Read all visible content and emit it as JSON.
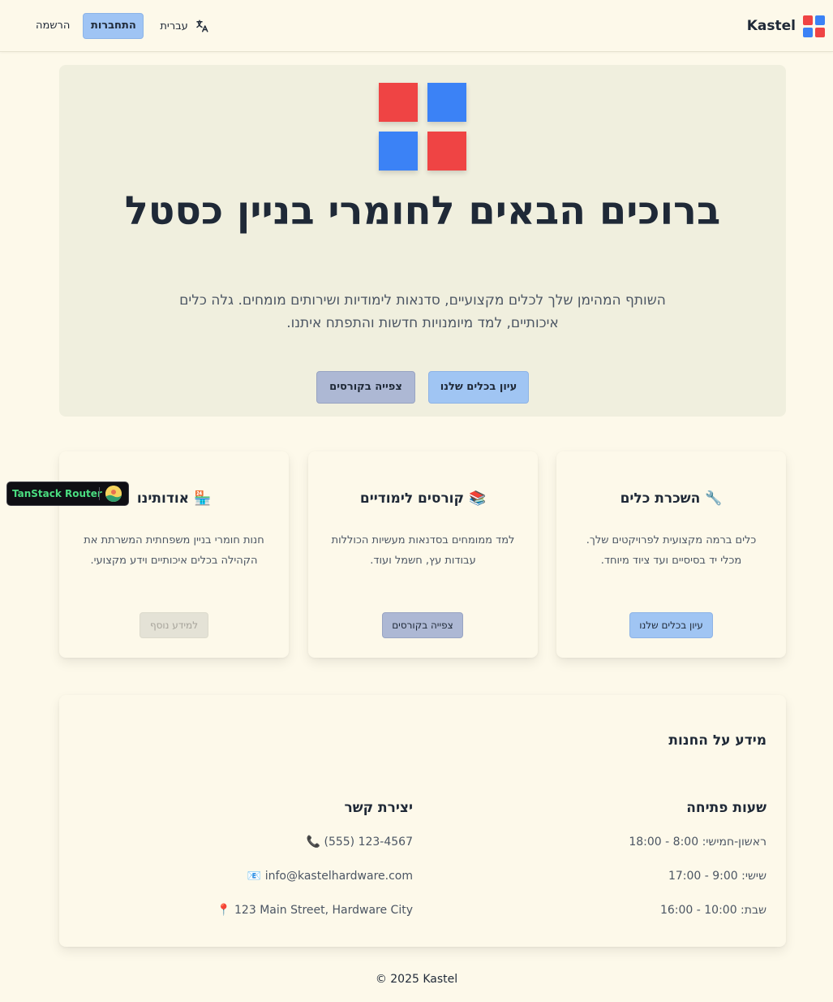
{
  "header": {
    "brand": "Kastel",
    "language_label": "עברית",
    "login_label": "התחברות",
    "register_label": "הרשמה"
  },
  "hero": {
    "title": "ברוכים הבאים לחומרי בניין כסטל",
    "subtitle": "השותף המהימן שלך לכלים מקצועיים, סדנאות לימודיות ושירותים מומחים. גלה כלים איכותיים, למד מיומנויות חדשות והתפתח איתנו.",
    "browse_button": "עיון בכלים שלנו",
    "courses_button": "צפייה בקורסים"
  },
  "cards": {
    "rent": {
      "title": "🔧 השכרת כלים",
      "description": "כלים ברמה מקצועית לפרויקטים שלך. מכלי יד בסיסיים ועד ציוד מיוחד.",
      "button": "עיון בכלים שלנו"
    },
    "courses": {
      "title": "📚 קורסים לימודיים",
      "description": "למד ממומחים בסדנאות מעשיות הכוללות עבודות עץ, חשמל ועוד.",
      "button": "צפייה בקורסים"
    },
    "about": {
      "title": "🏪 אודותינו",
      "description": "חנות חומרי בניין משפחתית המשרתת את הקהילה בכלים איכותיים וידע מקצועי.",
      "button": "למידע נוסף"
    }
  },
  "devtools": {
    "label": "TanStack Router"
  },
  "store_info": {
    "title": "מידע על החנות",
    "hours": {
      "title": "שעות פתיחה",
      "lines": [
        "ראשון-חמישי: 8:00 - 18:00",
        "שישי: 9:00 - 17:00",
        "שבת: 10:00 - 16:00"
      ]
    },
    "contact": {
      "title": "יצירת קשר",
      "phone": "📞 (555) 123-4567",
      "email": "📧 info@kastelhardware.com",
      "address": "📍 123 Main Street, Hardware City"
    }
  },
  "footer": {
    "text": "© 2025 Kastel"
  },
  "colors": {
    "logo_red": "#ef4444",
    "logo_blue": "#3b82f6",
    "primary_button": "#a0c5f3",
    "secondary_button": "#adb8d4",
    "page_background": "#fdf9ea"
  }
}
